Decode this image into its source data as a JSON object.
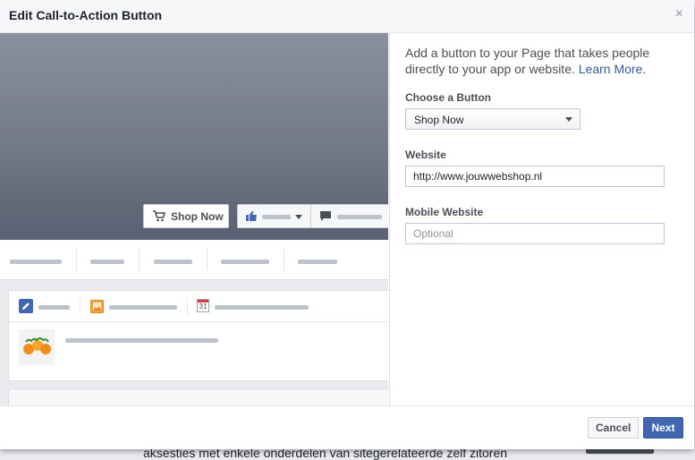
{
  "dialog": {
    "title": "Edit Call-to-Action Button",
    "close_icon": "×"
  },
  "preview": {
    "cta_label": "Shop Now",
    "calendar_day": "31"
  },
  "form": {
    "intro": "Add a button to your Page that takes people directly to your app or website.",
    "learn_more": "Learn More.",
    "choose_label": "Choose a Button",
    "choose_value": "Shop Now",
    "website_label": "Website",
    "website_value": "http://www.jouwwebshop.nl",
    "mobile_label": "Mobile Website",
    "mobile_placeholder": "Optional"
  },
  "footer": {
    "cancel": "Cancel",
    "next": "Next"
  },
  "background_page": {
    "text": "aksesties met enkele onderdelen van sitegerelateerde zelf zitoren"
  },
  "colors": {
    "accent": "#4267b2",
    "link": "#365899"
  }
}
